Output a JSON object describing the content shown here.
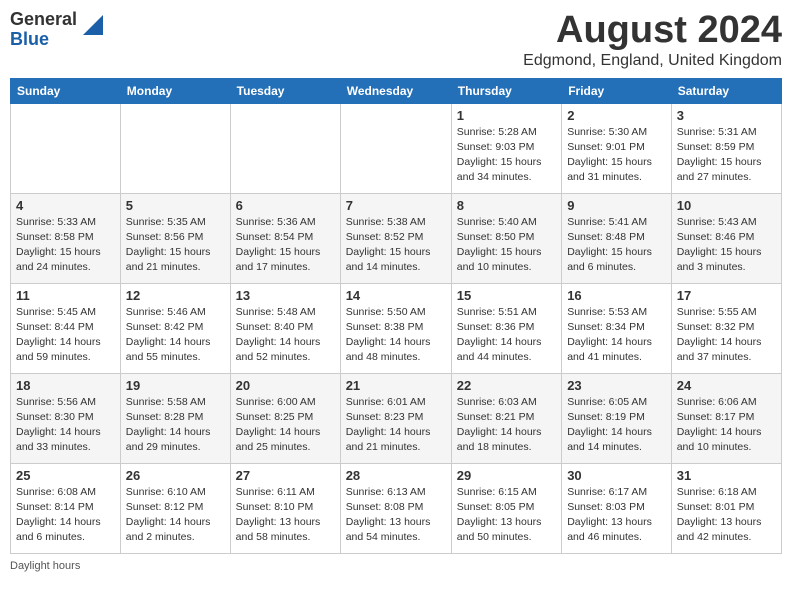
{
  "header": {
    "logo_general": "General",
    "logo_blue": "Blue",
    "month_year": "August 2024",
    "location": "Edgmond, England, United Kingdom"
  },
  "days_of_week": [
    "Sunday",
    "Monday",
    "Tuesday",
    "Wednesday",
    "Thursday",
    "Friday",
    "Saturday"
  ],
  "weeks": [
    [
      {
        "day": "",
        "info": ""
      },
      {
        "day": "",
        "info": ""
      },
      {
        "day": "",
        "info": ""
      },
      {
        "day": "",
        "info": ""
      },
      {
        "day": "1",
        "info": "Sunrise: 5:28 AM\nSunset: 9:03 PM\nDaylight: 15 hours and 34 minutes."
      },
      {
        "day": "2",
        "info": "Sunrise: 5:30 AM\nSunset: 9:01 PM\nDaylight: 15 hours and 31 minutes."
      },
      {
        "day": "3",
        "info": "Sunrise: 5:31 AM\nSunset: 8:59 PM\nDaylight: 15 hours and 27 minutes."
      }
    ],
    [
      {
        "day": "4",
        "info": "Sunrise: 5:33 AM\nSunset: 8:58 PM\nDaylight: 15 hours and 24 minutes."
      },
      {
        "day": "5",
        "info": "Sunrise: 5:35 AM\nSunset: 8:56 PM\nDaylight: 15 hours and 21 minutes."
      },
      {
        "day": "6",
        "info": "Sunrise: 5:36 AM\nSunset: 8:54 PM\nDaylight: 15 hours and 17 minutes."
      },
      {
        "day": "7",
        "info": "Sunrise: 5:38 AM\nSunset: 8:52 PM\nDaylight: 15 hours and 14 minutes."
      },
      {
        "day": "8",
        "info": "Sunrise: 5:40 AM\nSunset: 8:50 PM\nDaylight: 15 hours and 10 minutes."
      },
      {
        "day": "9",
        "info": "Sunrise: 5:41 AM\nSunset: 8:48 PM\nDaylight: 15 hours and 6 minutes."
      },
      {
        "day": "10",
        "info": "Sunrise: 5:43 AM\nSunset: 8:46 PM\nDaylight: 15 hours and 3 minutes."
      }
    ],
    [
      {
        "day": "11",
        "info": "Sunrise: 5:45 AM\nSunset: 8:44 PM\nDaylight: 14 hours and 59 minutes."
      },
      {
        "day": "12",
        "info": "Sunrise: 5:46 AM\nSunset: 8:42 PM\nDaylight: 14 hours and 55 minutes."
      },
      {
        "day": "13",
        "info": "Sunrise: 5:48 AM\nSunset: 8:40 PM\nDaylight: 14 hours and 52 minutes."
      },
      {
        "day": "14",
        "info": "Sunrise: 5:50 AM\nSunset: 8:38 PM\nDaylight: 14 hours and 48 minutes."
      },
      {
        "day": "15",
        "info": "Sunrise: 5:51 AM\nSunset: 8:36 PM\nDaylight: 14 hours and 44 minutes."
      },
      {
        "day": "16",
        "info": "Sunrise: 5:53 AM\nSunset: 8:34 PM\nDaylight: 14 hours and 41 minutes."
      },
      {
        "day": "17",
        "info": "Sunrise: 5:55 AM\nSunset: 8:32 PM\nDaylight: 14 hours and 37 minutes."
      }
    ],
    [
      {
        "day": "18",
        "info": "Sunrise: 5:56 AM\nSunset: 8:30 PM\nDaylight: 14 hours and 33 minutes."
      },
      {
        "day": "19",
        "info": "Sunrise: 5:58 AM\nSunset: 8:28 PM\nDaylight: 14 hours and 29 minutes."
      },
      {
        "day": "20",
        "info": "Sunrise: 6:00 AM\nSunset: 8:25 PM\nDaylight: 14 hours and 25 minutes."
      },
      {
        "day": "21",
        "info": "Sunrise: 6:01 AM\nSunset: 8:23 PM\nDaylight: 14 hours and 21 minutes."
      },
      {
        "day": "22",
        "info": "Sunrise: 6:03 AM\nSunset: 8:21 PM\nDaylight: 14 hours and 18 minutes."
      },
      {
        "day": "23",
        "info": "Sunrise: 6:05 AM\nSunset: 8:19 PM\nDaylight: 14 hours and 14 minutes."
      },
      {
        "day": "24",
        "info": "Sunrise: 6:06 AM\nSunset: 8:17 PM\nDaylight: 14 hours and 10 minutes."
      }
    ],
    [
      {
        "day": "25",
        "info": "Sunrise: 6:08 AM\nSunset: 8:14 PM\nDaylight: 14 hours and 6 minutes."
      },
      {
        "day": "26",
        "info": "Sunrise: 6:10 AM\nSunset: 8:12 PM\nDaylight: 14 hours and 2 minutes."
      },
      {
        "day": "27",
        "info": "Sunrise: 6:11 AM\nSunset: 8:10 PM\nDaylight: 13 hours and 58 minutes."
      },
      {
        "day": "28",
        "info": "Sunrise: 6:13 AM\nSunset: 8:08 PM\nDaylight: 13 hours and 54 minutes."
      },
      {
        "day": "29",
        "info": "Sunrise: 6:15 AM\nSunset: 8:05 PM\nDaylight: 13 hours and 50 minutes."
      },
      {
        "day": "30",
        "info": "Sunrise: 6:17 AM\nSunset: 8:03 PM\nDaylight: 13 hours and 46 minutes."
      },
      {
        "day": "31",
        "info": "Sunrise: 6:18 AM\nSunset: 8:01 PM\nDaylight: 13 hours and 42 minutes."
      }
    ]
  ],
  "footer": {
    "note": "Daylight hours"
  }
}
